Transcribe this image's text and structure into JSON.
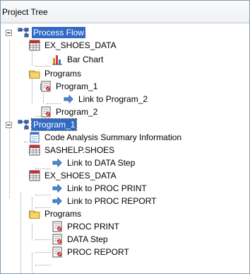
{
  "window": {
    "title": "Project Tree"
  },
  "tree": [
    {
      "label": "Process Flow",
      "icon": "process-flow-icon",
      "expanded": true,
      "selected": true
    },
    {
      "label": "EX_SHOES_DATA",
      "icon": "data-table-icon",
      "expanded": true
    },
    {
      "label": "Bar Chart",
      "icon": "bar-chart-icon"
    },
    {
      "label": "Programs",
      "icon": "folder-icon",
      "expanded": true
    },
    {
      "label": "Program_1",
      "icon": "program-icon",
      "expanded": true
    },
    {
      "label": "Link to Program_2",
      "icon": "link-arrow-icon"
    },
    {
      "label": "Program_2",
      "icon": "program-icon"
    },
    {
      "label": "Program_1",
      "icon": "process-flow-icon",
      "expanded": true,
      "selected": true
    },
    {
      "label": "Code Analysis Summary Information",
      "icon": "summary-document-icon"
    },
    {
      "label": "SASHELP.SHOES",
      "icon": "data-table-icon",
      "expanded": true
    },
    {
      "label": "Link to DATA Step",
      "icon": "link-arrow-icon"
    },
    {
      "label": "EX_SHOES_DATA",
      "icon": "data-table-icon",
      "expanded": true
    },
    {
      "label": "Link to PROC PRINT",
      "icon": "link-arrow-icon"
    },
    {
      "label": "Link to PROC REPORT",
      "icon": "link-arrow-icon"
    },
    {
      "label": "Programs",
      "icon": "folder-icon",
      "expanded": true
    },
    {
      "label": "PROC PRINT",
      "icon": "program-icon"
    },
    {
      "label": "DATA Step",
      "icon": "program-icon"
    },
    {
      "label": "PROC REPORT",
      "icon": "program-icon"
    }
  ]
}
